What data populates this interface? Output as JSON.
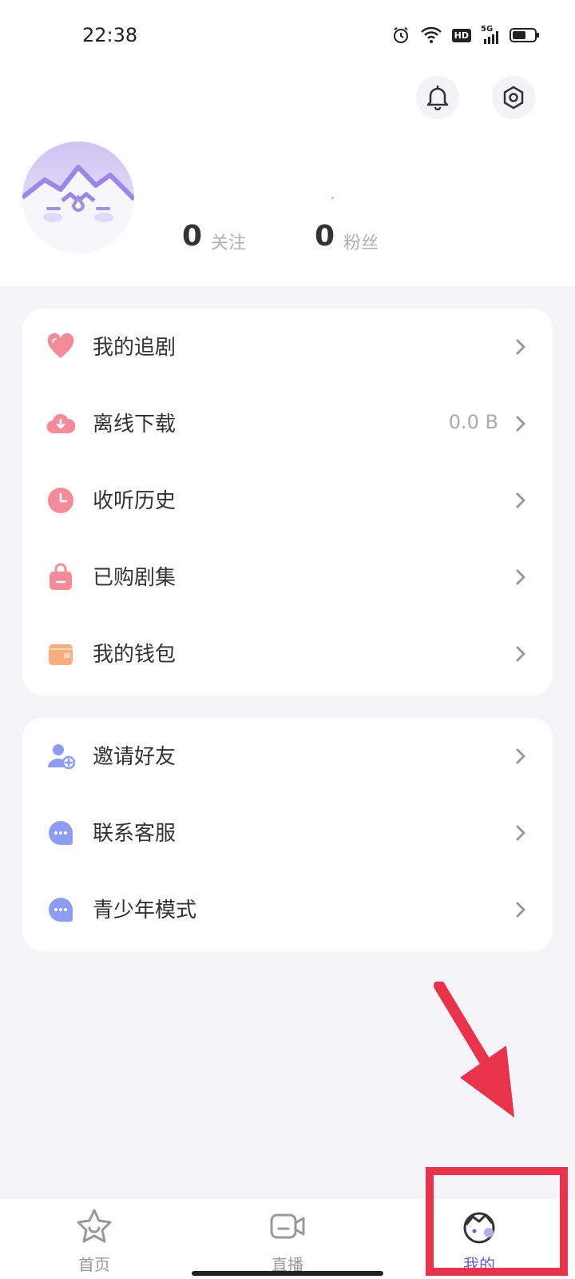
{
  "status_bar": {
    "time": "22:38",
    "icons": [
      "alarm-icon",
      "wifi-icon",
      "hd-icon",
      "signal-5g-icon",
      "battery-icon"
    ],
    "hd_label": "HD",
    "network_label": "5G"
  },
  "header": {
    "icons": [
      "bell-icon",
      "settings-icon"
    ]
  },
  "profile": {
    "following_count": "0",
    "following_label": "关注",
    "followers_count": "0",
    "followers_label": "粉丝"
  },
  "menu_group_1": [
    {
      "label": "我的追剧",
      "icon": "heart-icon",
      "value": ""
    },
    {
      "label": "离线下载",
      "icon": "cloud-download-icon",
      "value": "0.0 B"
    },
    {
      "label": "收听历史",
      "icon": "clock-icon",
      "value": ""
    },
    {
      "label": "已购剧集",
      "icon": "bag-icon",
      "value": ""
    },
    {
      "label": "我的钱包",
      "icon": "wallet-icon",
      "value": ""
    }
  ],
  "menu_group_2": [
    {
      "label": "邀请好友",
      "icon": "add-friend-icon"
    },
    {
      "label": "联系客服",
      "icon": "chat-bubble-icon"
    },
    {
      "label": "青少年模式",
      "icon": "teen-mode-icon"
    }
  ],
  "bottom_nav": [
    {
      "label": "首页",
      "icon": "star-face-icon",
      "active": false
    },
    {
      "label": "直播",
      "icon": "video-camera-icon",
      "active": false
    },
    {
      "label": "我的",
      "icon": "profile-face-icon",
      "active": true
    }
  ],
  "colors": {
    "accent": "#6b5bd2",
    "pink": "#f07a8a",
    "orange": "#f6a36e",
    "blue": "#7b8ef0",
    "annotation_red": "#e8334a",
    "background": "#f4f4f9"
  }
}
